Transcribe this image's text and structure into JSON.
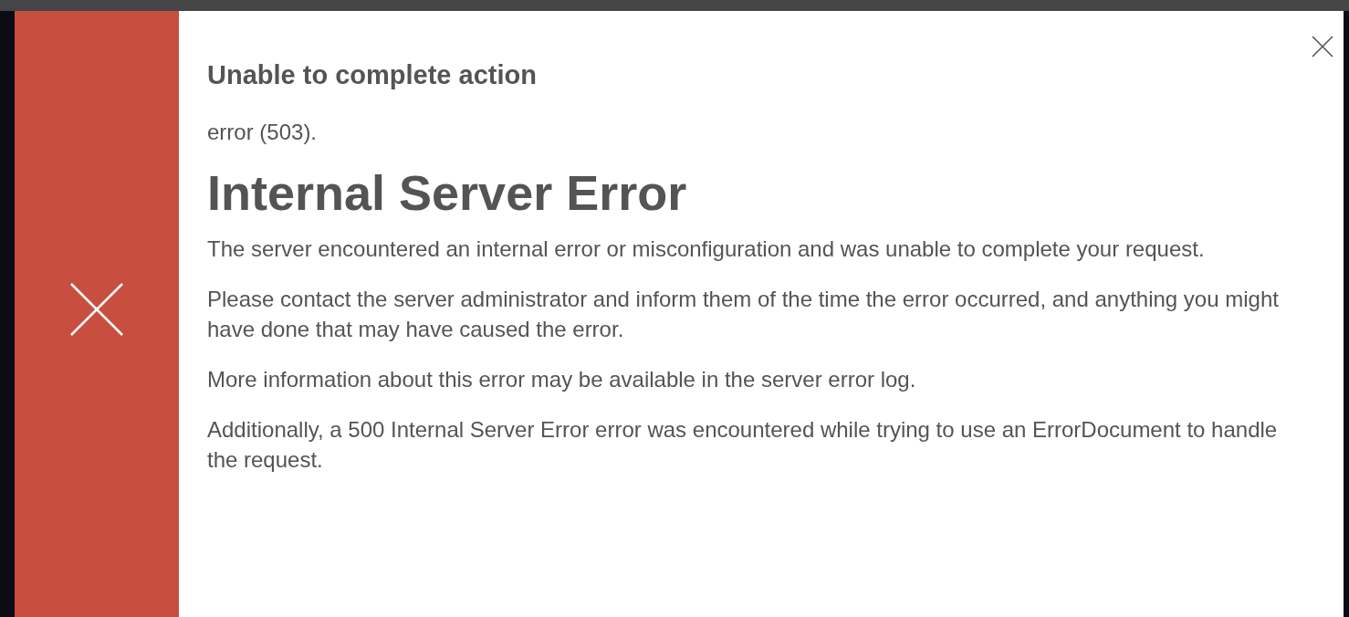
{
  "dialog": {
    "title": "Unable to complete action",
    "message": "error (503).",
    "heading": "Internal Server Error",
    "paragraphs": [
      "The server encountered an internal error or misconfiguration and was unable to complete your request.",
      "Please contact the server administrator and inform them of the time the error occurred, and anything you might have done that may have caused the error.",
      "More information about this error may be available in the server error log.",
      "Additionally, a 500 Internal Server Error error was encountered while trying to use an ErrorDocument to handle the request."
    ]
  }
}
